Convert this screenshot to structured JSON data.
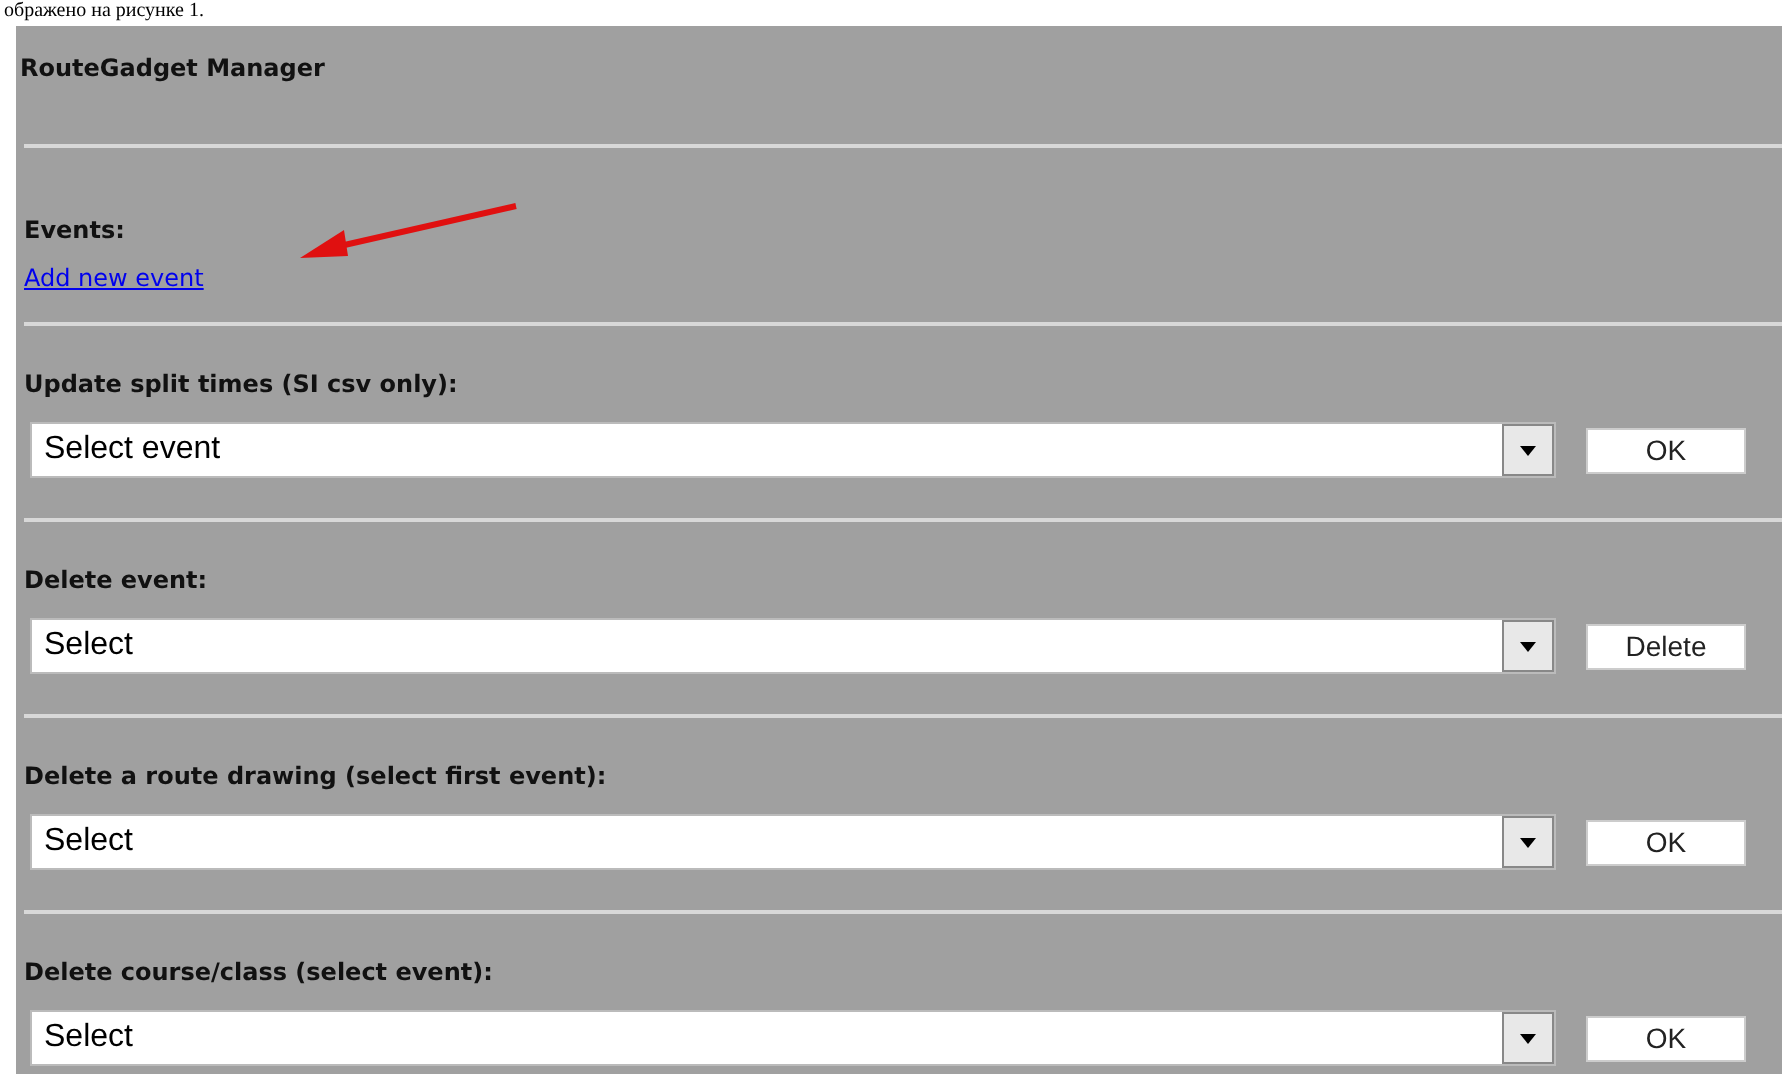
{
  "caption": "ображено на рисунке 1.",
  "title": "RouteGadget Manager",
  "events": {
    "label": "Events:",
    "link": "Add new event"
  },
  "sections": [
    {
      "label": "Update split times (SI csv only):",
      "select": "Select event",
      "button": "OK"
    },
    {
      "label": "Delete event:",
      "select": "Select",
      "button": "Delete"
    },
    {
      "label": "Delete a route drawing (select first event):",
      "select": "Select",
      "button": "OK"
    },
    {
      "label": "Delete course/class (select event):",
      "select": "Select",
      "button": "OK"
    }
  ]
}
